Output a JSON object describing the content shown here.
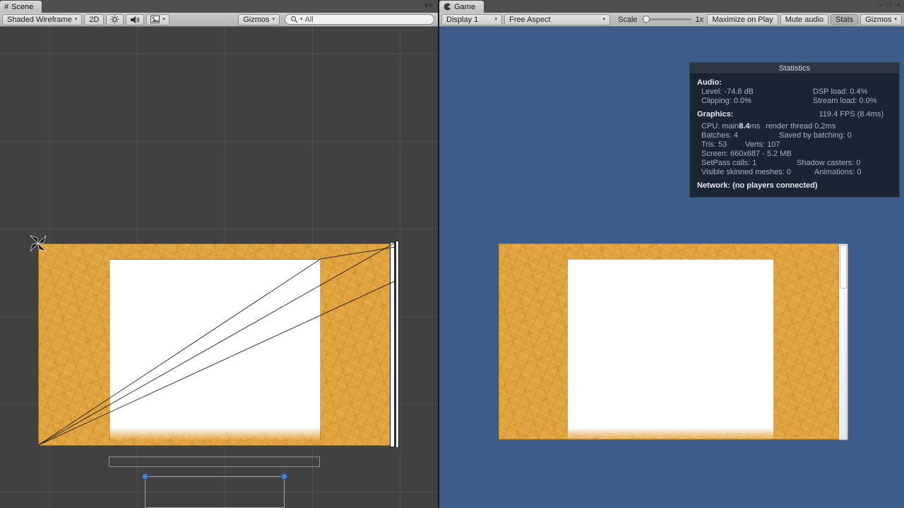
{
  "icons": {
    "dropdown": "▾"
  },
  "window_controls": {
    "minimize": "–",
    "maximize": "□",
    "close": "×"
  },
  "scene": {
    "tab_icon": "#",
    "tab_label": "Scene",
    "menu_icon": "▾≡",
    "toolbar": {
      "draw_mode": "Shaded Wireframe",
      "mode_2d": "2D",
      "gizmos": "Gizmos",
      "search_value": "All"
    }
  },
  "game": {
    "tab_label": "Game",
    "toolbar": {
      "display": "Display 1",
      "aspect": "Free Aspect",
      "scale_label": "Scale",
      "scale_value": "1x",
      "maximize_on_play": "Maximize on Play",
      "mute_audio": "Mute audio",
      "stats": "Stats",
      "gizmos": "Gizmos"
    },
    "stats": {
      "title": "Statistics",
      "audio_label": "Audio:",
      "level": "Level: -74.8 dB",
      "dsp_load": "DSP load: 0.4%",
      "clipping": "Clipping: 0.0%",
      "stream_load": "Stream load: 0.0%",
      "graphics_label": "Graphics:",
      "fps": "119.4 FPS (8.4ms)",
      "cpu_prefix": "CPU: main ",
      "cpu_bold": "8.4",
      "cpu_unit": "ms",
      "cpu_render_thread": "render thread 0.2ms",
      "batches": "Batches: 4",
      "saved_by_batching": "Saved by batching: 0",
      "tris": "Tris: 53",
      "verts": "Verts: 107",
      "screen": "Screen: 660x687 - 5.2 MB",
      "setpass_calls": "SetPass calls: 1",
      "shadow_casters": "Shadow casters: 0",
      "visible_skinned_meshes": "Visible skinned meshes: 0",
      "animations": "Animations: 0",
      "network": "Network: (no players connected)"
    }
  },
  "colors": {
    "scene_bg": "#414141",
    "game_bg": "#3b5b89",
    "book_orange": "#e2a43f",
    "handle_blue": "#4d7edc",
    "stats_bg": "#18212c"
  }
}
